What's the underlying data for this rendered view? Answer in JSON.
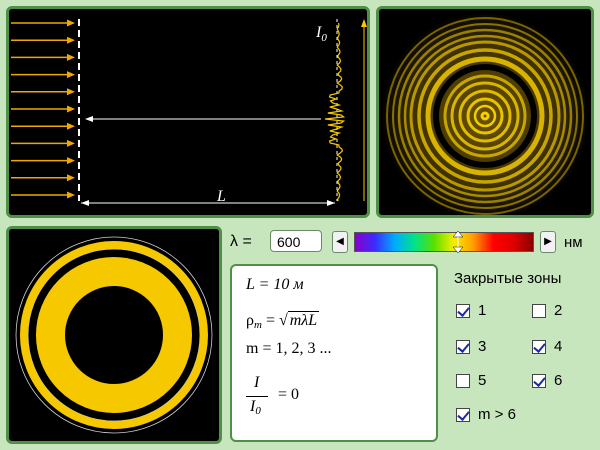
{
  "diagram": {
    "intensity_label": "I",
    "intensity_sub": "0",
    "distance_label": "L"
  },
  "controls": {
    "lambda_label": "λ =",
    "lambda_value": "600",
    "decrease_label": "◀",
    "increase_label": "▶",
    "unit": "нм",
    "slider_value_fraction": 0.58
  },
  "formulas": {
    "distance": "L = 10 м",
    "rho_base": "ρ",
    "rho_sub": "m",
    "rho_eq": " = √",
    "rho_rad": "mλL",
    "m_line": "m = 1, 2, 3 ...",
    "ratio_num": "I",
    "ratio_den": "I",
    "ratio_den_sub": "0",
    "ratio_eq": "= 0"
  },
  "zones": {
    "title": "Закрытые зоны",
    "items": [
      {
        "label": "1",
        "checked": true
      },
      {
        "label": "2",
        "checked": false
      },
      {
        "label": "3",
        "checked": true
      },
      {
        "label": "4",
        "checked": true
      },
      {
        "label": "5",
        "checked": false
      },
      {
        "label": "6",
        "checked": true
      },
      {
        "label": "m > 6",
        "checked": true
      }
    ]
  },
  "colors": {
    "panel_border": "#4f8f48",
    "ray": "#f0a800",
    "pattern": "#f6c800",
    "background": "#c8e6be"
  }
}
